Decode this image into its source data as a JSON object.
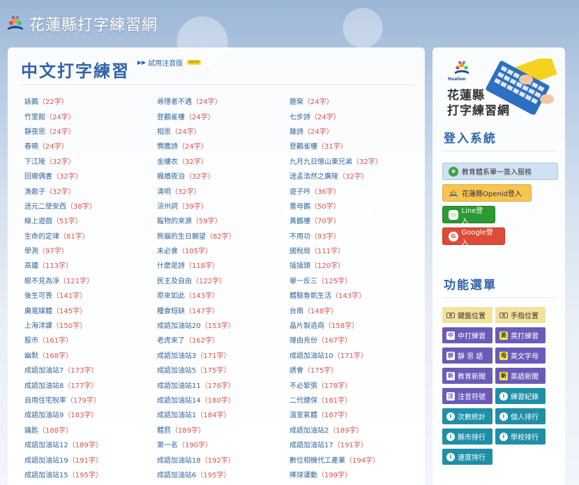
{
  "header": {
    "site_title": "花蓮縣打字練習網"
  },
  "main": {
    "title": "中文打字練習",
    "zhuyin_link": "試用注音版",
    "new_badge": "NEW",
    "lessons": [
      [
        "詠鵝",
        "（22字）"
      ],
      [
        "尋隱者不遇",
        "（24字）"
      ],
      [
        "鹿柴",
        "（24字）"
      ],
      [
        "竹里館",
        "（24字）"
      ],
      [
        "登鸛雀樓",
        "（24字）"
      ],
      [
        "七步詩",
        "（24字）"
      ],
      [
        "靜夜思",
        "（24字）"
      ],
      [
        "相思",
        "（24字）"
      ],
      [
        "雜詩",
        "（24字）"
      ],
      [
        "春曉",
        "（24字）"
      ],
      [
        "憫農詩",
        "（24字）"
      ],
      [
        "登鸛雀樓",
        "（31字）"
      ],
      [
        "下江陵",
        "（32字）"
      ],
      [
        "金縷衣",
        "（32字）"
      ],
      [
        "九月九日憶山東兄弟",
        "（32字）"
      ],
      [
        "回鄉偶書",
        "（32字）"
      ],
      [
        "楓橋夜泊",
        "（32字）"
      ],
      [
        "送孟浩然之廣陵",
        "（32字）"
      ],
      [
        "漁歌子",
        "（32字）"
      ],
      [
        "清明",
        "（32字）"
      ],
      [
        "遊子吟",
        "（36字）"
      ],
      [
        "送元二使安西",
        "（38字）"
      ],
      [
        "涼州詞",
        "（39字）"
      ],
      [
        "蕾母鵝",
        "（50字）"
      ],
      [
        "線上遊戲",
        "（51字）"
      ],
      [
        "寵物的來源",
        "（59字）"
      ],
      [
        "黃鶴樓",
        "（70字）"
      ],
      [
        "生命的定律",
        "（81字）"
      ],
      [
        "熊貓的生日願望",
        "（82字）"
      ],
      [
        "不用功",
        "（93字）"
      ],
      [
        "學測",
        "（97字）"
      ],
      [
        "未必會",
        "（105字）"
      ],
      [
        "國稅局",
        "（111字）"
      ],
      [
        "高鐵",
        "（113字）"
      ],
      [
        "什麼是詩",
        "（118字）"
      ],
      [
        "插插頭",
        "（120字）"
      ],
      [
        "眼不見為淨",
        "（121字）"
      ],
      [
        "民主及自由",
        "（122字）"
      ],
      [
        "舉一反三",
        "（125字）"
      ],
      [
        "後生可畏",
        "（141字）"
      ],
      [
        "原來如此",
        "（143字）"
      ],
      [
        "體驗魯凱生活",
        "（143字）"
      ],
      [
        "廣電媒體",
        "（145字）"
      ],
      [
        "糧食短缺",
        "（147字）"
      ],
      [
        "台南",
        "（148字）"
      ],
      [
        "上海洋課",
        "（150字）"
      ],
      [
        "成語加油站20",
        "（153字）"
      ],
      [
        "晶片製造商",
        "（158字）"
      ],
      [
        "股市",
        "（161字）"
      ],
      [
        "老虎來了",
        "（162字）"
      ],
      [
        "理由充份",
        "（167字）"
      ],
      [
        "幽默",
        "（168字）"
      ],
      [
        "成語加油站3",
        "（171字）"
      ],
      [
        "成語加油站10",
        "（171字）"
      ],
      [
        "成語加油站7",
        "（173字）"
      ],
      [
        "成語加油站5",
        "（175字）"
      ],
      [
        "誘會",
        "（175字）"
      ],
      [
        "成語加油站8",
        "（177字）"
      ],
      [
        "成語加油站11",
        "（178字）"
      ],
      [
        "不必緊張",
        "（178字）"
      ],
      [
        "自用住宅稅率",
        "（179字）"
      ],
      [
        "成語加油站14",
        "（180字）"
      ],
      [
        "二代健保",
        "（181字）"
      ],
      [
        "成語加油站9",
        "（183字）"
      ],
      [
        "成語加油站1",
        "（184字）"
      ],
      [
        "溫室氣體",
        "（187字）"
      ],
      [
        "鑰匙",
        "（188字）"
      ],
      [
        "體罰",
        "（189字）"
      ],
      [
        "成語加油站2",
        "（189字）"
      ],
      [
        "成語加油站12",
        "（189字）"
      ],
      [
        "第一名",
        "（190字）"
      ],
      [
        "成語加油站17",
        "（191字）"
      ],
      [
        "成語加油站19",
        "（191字）"
      ],
      [
        "成語加油站18",
        "（192字）"
      ],
      [
        "數位相機代工產業",
        "（194字）"
      ],
      [
        "成語加油站15",
        "（195字）"
      ],
      [
        "成語加油站6",
        "（195字）"
      ],
      [
        "棒球運動",
        "（199字）"
      ]
    ]
  },
  "sidebar": {
    "logo": {
      "caption": "Hualien",
      "line1": "花蓮縣",
      "line2": "打字練習網"
    },
    "login_title": "登入系統",
    "login_buttons": {
      "edu": "教育體系單一簽入服務",
      "openid": "花蓮縣Openid登入",
      "line": "Line登入",
      "google": "Google登入"
    },
    "func_title": "功能選單",
    "func_buttons": {
      "keyboard": "鍵盤位置",
      "finger": "手指位置",
      "zh_typing": "中打練習",
      "en_typing": "英打練習",
      "jingsi": "靜 思 語",
      "en_letters": "英文字母",
      "edu_news": "教育新聞",
      "en_news": "英語新聞",
      "zhuyin": "注音符號",
      "records": "練習紀錄",
      "count_stats": "次數統計",
      "personal_rank": "個人排行",
      "county_rank": "縣市排行",
      "school_rank": "學校排行",
      "speed_rank": "速度排行"
    },
    "icons": {
      "zh": "中",
      "en": "英",
      "jing": "靜",
      "mu": "母",
      "xin": "新",
      "zhu": "注",
      "info": "i"
    }
  }
}
